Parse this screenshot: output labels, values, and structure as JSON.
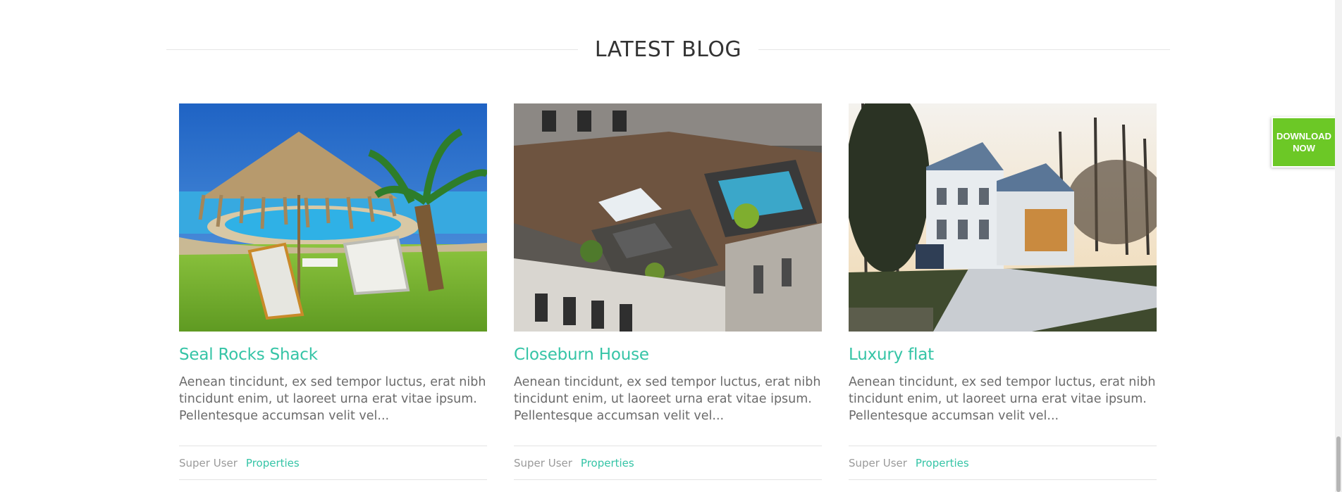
{
  "section": {
    "title": "LATEST BLOG"
  },
  "posts": [
    {
      "title": "Seal Rocks Shack",
      "excerpt": "Aenean tincidunt, ex sed tempor luctus, erat nibh tincidunt enim, ut laoreet urna erat vitae ipsum. Pellentesque accumsan velit vel...",
      "author": "Super User",
      "category": "Properties",
      "image": "pool-umbrella-photo"
    },
    {
      "title": "Closeburn House",
      "excerpt": "Aenean tincidunt, ex sed tempor luctus, erat nibh tincidunt enim, ut laoreet urna erat vitae ipsum. Pellentesque accumsan velit vel...",
      "author": "Super User",
      "category": "Properties",
      "image": "rooftop-terrace-photo"
    },
    {
      "title": "Luxury flat",
      "excerpt": "Aenean tincidunt, ex sed tempor luctus, erat nibh tincidunt enim, ut laoreet urna erat vitae ipsum. Pellentesque accumsan velit vel...",
      "author": "Super User",
      "category": "Properties",
      "image": "white-mansion-photo"
    }
  ],
  "download": {
    "line1": "DOWNLOAD",
    "line2": "NOW"
  },
  "colors": {
    "accent": "#35c4a6",
    "download_bg": "#6cc826",
    "text": "#6b6b6b",
    "heading": "#333333"
  }
}
